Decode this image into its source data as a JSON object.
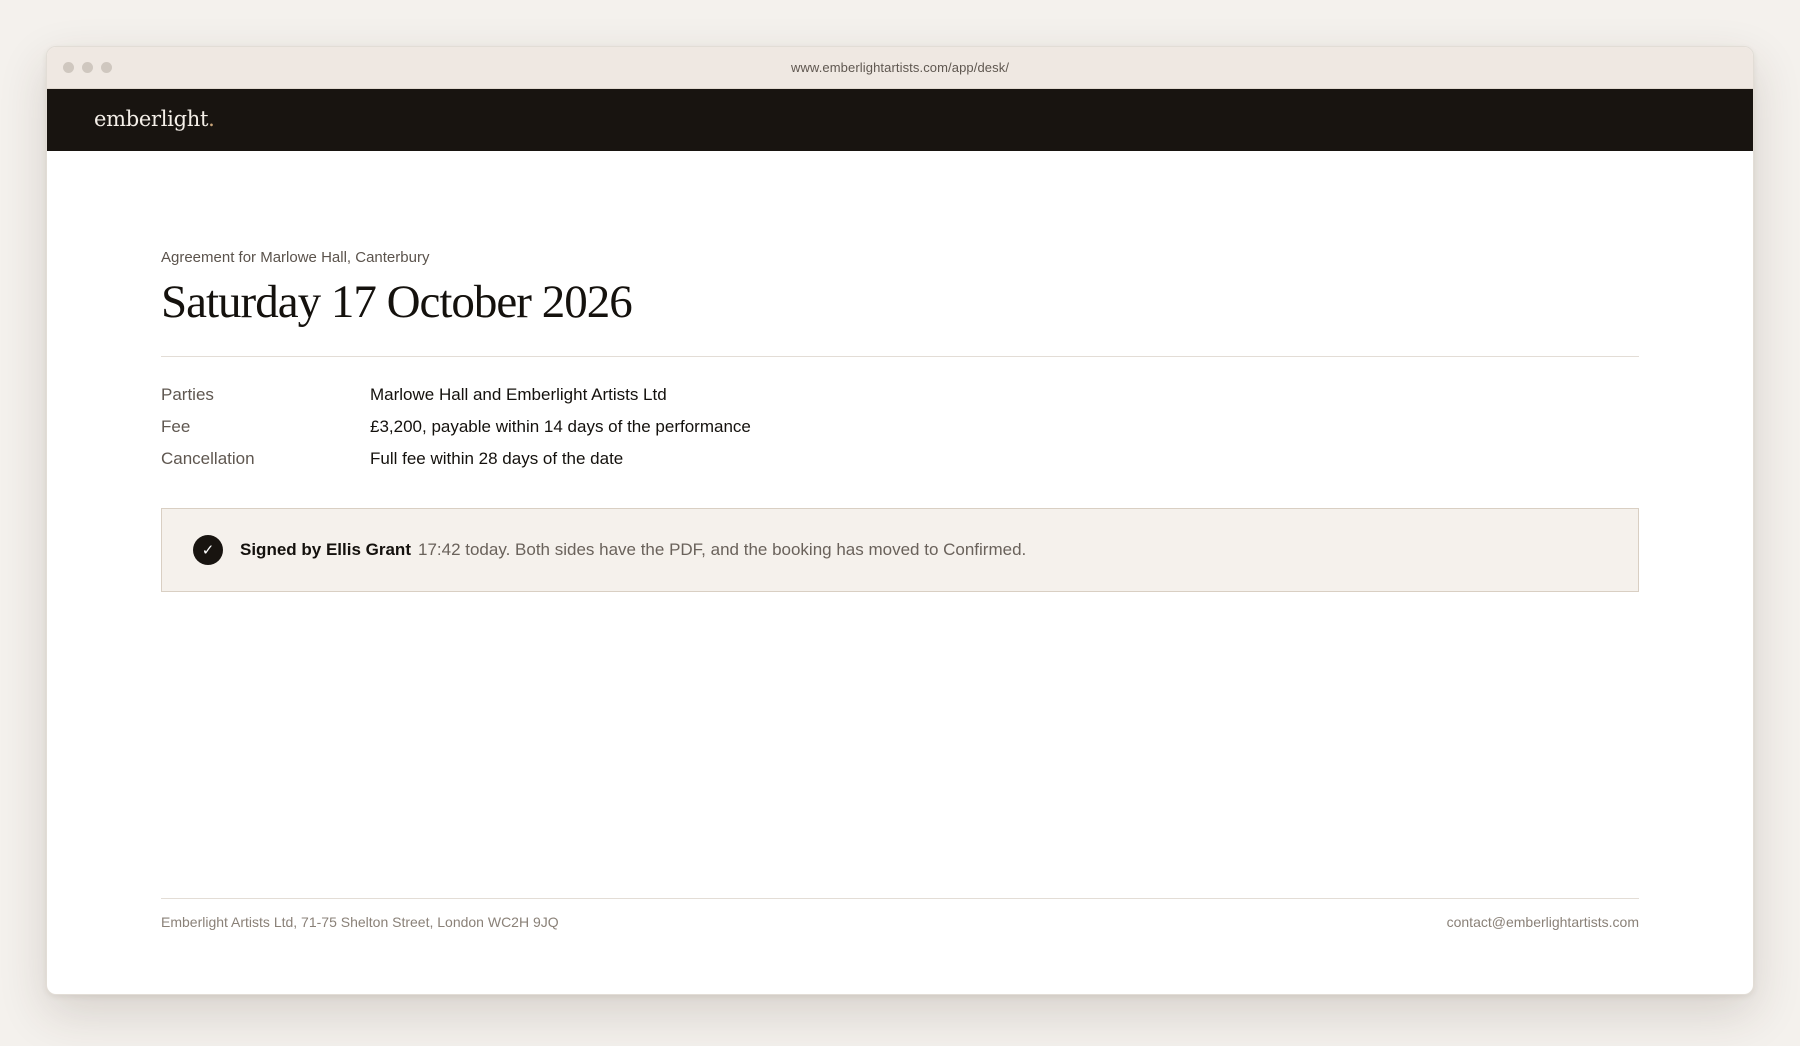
{
  "browser": {
    "url": "www.emberlightartists.com/app/desk/"
  },
  "brand": {
    "name": "emberlight",
    "mark": ".",
    "mark_color": "#c9a57a"
  },
  "agreement": {
    "eyebrow": "Agreement for Marlowe Hall, Canterbury",
    "title": "Saturday 17 October 2026",
    "terms": [
      {
        "label": "Parties",
        "value": "Marlowe Hall and Emberlight Artists Ltd"
      },
      {
        "label": "Fee",
        "value": "£3,200, payable within 14 days of the performance"
      },
      {
        "label": "Cancellation",
        "value": "Full fee within 28 days of the date"
      }
    ]
  },
  "notice": {
    "icon": "check-icon",
    "icon_glyph": "✓",
    "signed_by": "Signed by Ellis Grant",
    "detail": "17:42 today. Both sides have the PDF, and the booking has moved to Confirmed."
  },
  "footer": {
    "address": "Emberlight Artists Ltd, 71-75 Shelton Street, London WC2H 9JQ",
    "contact": "contact@emberlightartists.com"
  },
  "colors": {
    "nav_background": "#181410",
    "notice_background": "#f5f1ec",
    "page_background": "#f4f1ed"
  }
}
